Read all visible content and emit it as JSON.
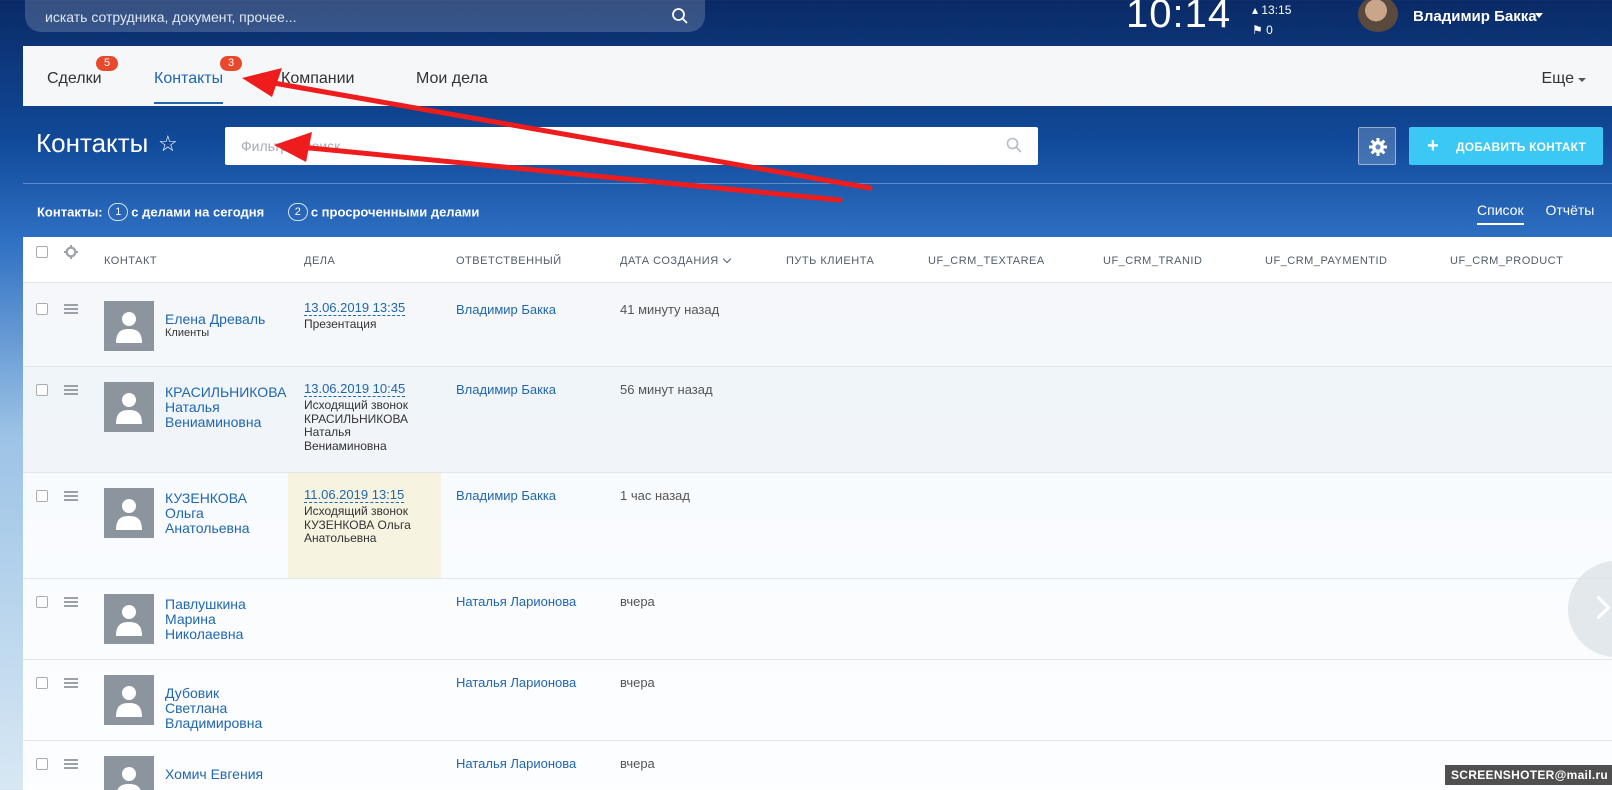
{
  "top": {
    "search_placeholder": "искать сотрудника, документ, прочее...",
    "time": "10:14",
    "alarm_time": "13:15",
    "flag_count": "0",
    "user_name": "Владимир Бакка"
  },
  "tabs": [
    {
      "label": "Сделки",
      "badge": "5"
    },
    {
      "label": "Контакты",
      "badge": "3"
    },
    {
      "label": "Компании"
    },
    {
      "label": "Мои дела"
    }
  ],
  "more_label": "Еще",
  "page": {
    "title": "Контакты",
    "filter_placeholder": "Фильтр + поиск",
    "add_button": "ДОБАВИТЬ КОНТАКТ"
  },
  "counters": {
    "prefix": "Контакты:",
    "today_count": "1",
    "today_label": "с делами на сегодня",
    "overdue_count": "2",
    "overdue_label": "с просроченными делами"
  },
  "views": {
    "list": "Список",
    "reports": "Отчёты"
  },
  "columns": [
    "КОНТАКТ",
    "ДЕЛА",
    "ОТВЕТСТВЕННЫЙ",
    "ДАТА СОЗДАНИЯ",
    "ПУТЬ КЛИЕНТА",
    "UF_CRM_TEXTAREA",
    "UF_CRM_TRANID",
    "UF_CRM_PAYMENTID",
    "UF_CRM_PRODUCT"
  ],
  "rows": [
    {
      "name": "Елена Древаль",
      "sub": "Клиенты",
      "deal_date": "13.06.2019 13:35",
      "deal_desc": "Презентация",
      "responsible": "Владимир Бакка",
      "created": "41 минуту назад"
    },
    {
      "name": "КРАСИЛЬНИКОВА Наталья Вениаминовна",
      "sub": "",
      "deal_date": "13.06.2019 10:45",
      "deal_desc": "Исходящий звонок КРАСИЛЬНИКОВА Наталья Вениаминовна",
      "responsible": "Владимир Бакка",
      "created": "56 минут назад"
    },
    {
      "name": "КУЗЕНКОВА Ольга Анатольевна",
      "sub": "",
      "deal_date": "11.06.2019 13:15",
      "deal_desc": "Исходящий звонок КУЗЕНКОВА Ольга Анатольевна",
      "responsible": "Владимир Бакка",
      "created": "1 час назад"
    },
    {
      "name": "Павлушкина Марина Николаевна",
      "sub": "",
      "deal_date": "",
      "deal_desc": "",
      "responsible": "Наталья Ларионова",
      "created": "вчера"
    },
    {
      "name": "Дубовик Светлана Владимировна",
      "sub": "",
      "deal_date": "",
      "deal_desc": "",
      "responsible": "Наталья Ларионова",
      "created": "вчера"
    },
    {
      "name": "Хомич Евгения",
      "sub": "",
      "deal_date": "",
      "deal_desc": "",
      "responsible": "Наталья Ларионова",
      "created": "вчера"
    }
  ],
  "watermark": "SCREENSHOTER@mail.ru",
  "colors": {
    "accent": "#2067b0",
    "badge": "#e8492c",
    "add_button": "#3bc8f5",
    "overdue_highlight": "#f7f3e1",
    "annotation_arrow": "#ee1c1c"
  }
}
